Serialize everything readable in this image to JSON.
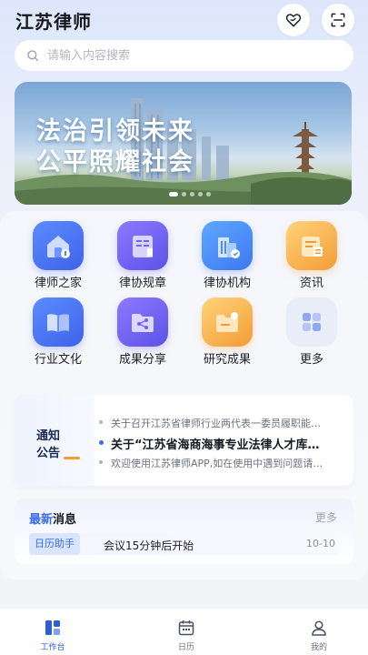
{
  "header": {
    "title": "江苏律师",
    "favorite_icon": "heart-hand-icon",
    "scan_icon": "scan-icon"
  },
  "search": {
    "placeholder": "请输入内容搜索",
    "icon": "search-icon"
  },
  "banner": {
    "line1": "法治引领未来",
    "line2": "公平照耀社会",
    "slide_count": 5,
    "active_slide": 0
  },
  "grid": {
    "items": [
      {
        "label": "律师之家",
        "icon": "home-icon",
        "color": "#4f7bff"
      },
      {
        "label": "律协规章",
        "icon": "book-icon",
        "color": "#6f63f5"
      },
      {
        "label": "律协机构",
        "icon": "building-icon",
        "color": "#4a8cf8"
      },
      {
        "label": "资讯",
        "icon": "news-icon",
        "color": "#f5a943"
      },
      {
        "label": "行业文化",
        "icon": "open-book-icon",
        "color": "#4f7bff"
      },
      {
        "label": "成果分享",
        "icon": "share-folder-icon",
        "color": "#6f63f5"
      },
      {
        "label": "研究成果",
        "icon": "idea-folder-icon",
        "color": "#f5a943"
      },
      {
        "label": "更多",
        "icon": "grid-icon",
        "color": "#7f9cf5"
      }
    ]
  },
  "notice": {
    "badge_line1": "通知",
    "badge_line2": "公告",
    "items": [
      "关于召开江苏省律师行业两代表一委员履职能力提升培训班的通知",
      "关于“江苏省海商海事专业法律人才库”入库人员名单的公示",
      "欢迎使用江苏律师APP,如在使用中遇到问题请及时反馈"
    ]
  },
  "news": {
    "title_accent": "最新",
    "title_rest": "消息",
    "more": "更多",
    "items": [
      {
        "tag": "日历助手",
        "text": "会议15分钟后开始",
        "date": "10-10"
      }
    ]
  },
  "tabbar": {
    "tabs": [
      {
        "label": "工作台",
        "icon": "workbench-icon",
        "active": true
      },
      {
        "label": "日历",
        "icon": "calendar-icon",
        "active": false
      },
      {
        "label": "我的",
        "icon": "profile-icon",
        "active": false
      }
    ]
  },
  "colors": {
    "accent": "#3b6cf0",
    "active_tab": "#2f5bd6"
  }
}
